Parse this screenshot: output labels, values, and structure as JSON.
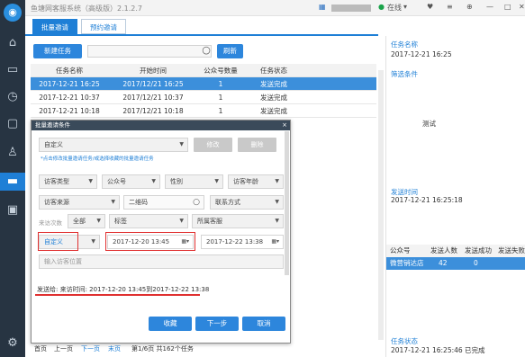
{
  "app": {
    "title": "鱼塘网客服系统（高级版）2.1.2.7",
    "status": "在线",
    "logo": "chat-bubble",
    "icons": [
      "home",
      "message",
      "history",
      "chat",
      "contacts",
      "broadcast",
      "video",
      "settings"
    ]
  },
  "tabs": [
    {
      "label": "批量邀请",
      "active": true
    },
    {
      "label": "预约邀请",
      "active": false
    }
  ],
  "toolbar": {
    "new_task": "新建任务",
    "refresh": "刷新",
    "search_placeholder": ""
  },
  "grid": {
    "columns": [
      "任务名称",
      "开始时间",
      "公众号数量",
      "任务状态"
    ],
    "rows": [
      {
        "name": "2017-12-21 16:25",
        "start": "2017/12/21 16:25",
        "count": "1",
        "status": "发送完成",
        "selected": true
      },
      {
        "name": "2017-12-21 10:37",
        "start": "2017/12/21 10:37",
        "count": "1",
        "status": "发送完成",
        "selected": false
      },
      {
        "name": "2017-12-21 10:18",
        "start": "2017/12/21 10:18",
        "count": "1",
        "status": "发送完成",
        "selected": false
      }
    ]
  },
  "pager": {
    "first": "首页",
    "prev": "上一页",
    "next": "下一页",
    "last": "末页",
    "info": "第1/6页 共162个任务"
  },
  "detail": {
    "task_name_label": "任务名称",
    "task_name": "2017-12-21 16:25",
    "filter_label": "筛选条件",
    "content_text": "测试",
    "send_time_label": "发送时间",
    "send_time": "2017-12-21 16:25:18",
    "stat_headers": [
      "公众号",
      "发送人数",
      "发送成功",
      "发送失败"
    ],
    "stat_row": {
      "account": "微营销达店",
      "sent": "42",
      "success": "0",
      "failed": ""
    },
    "status_label": "任务状态",
    "status_value": "2017-12-21 16:25:46 已完成"
  },
  "dialog": {
    "title": "批量邀请条件",
    "close": "×",
    "preset": "自定义",
    "modify": "修改",
    "delete": "删除",
    "hint": "*点击修改批量邀请任务/或选择收藏的批量邀请任务",
    "filters_row1": [
      "访客类型",
      "公众号",
      "性别",
      "访客年龄"
    ],
    "filters_row2": {
      "source": "访客来源",
      "qrcode": "二维码",
      "contact": "联系方式"
    },
    "visit_label": "来访次数",
    "visit_value": "全部",
    "tag": "标签",
    "staff": "所属客服",
    "time_preset": "自定义",
    "date_from": "2017-12-20 13:45",
    "date_to": "2017-12-22 13:38",
    "location_placeholder": "输入访客位置",
    "summary": "发送给: 来访时间: 2017-12-20 13:45到2017-12-22 13:38",
    "btn_fav": "收藏",
    "btn_next": "下一步",
    "btn_cancel": "取消"
  }
}
